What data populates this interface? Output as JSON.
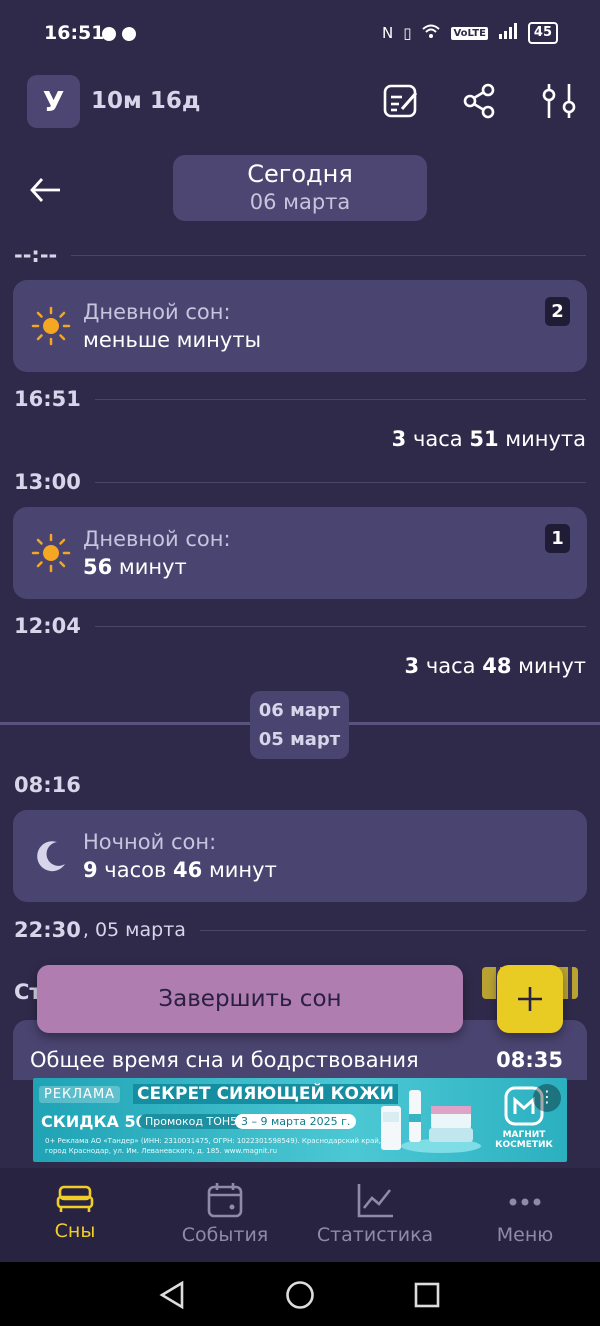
{
  "status_bar": {
    "time": "16:51",
    "network": "VoLTE",
    "battery": "45"
  },
  "top_bar": {
    "avatar_letter": "У",
    "age": "10м 16д"
  },
  "date_header": {
    "title": "Сегодня",
    "date": "06 марта"
  },
  "timeline": {
    "marker_empty": "--:--",
    "nap1": {
      "label": "Дневной сон:",
      "value": "меньше минуты",
      "badge": "2"
    },
    "time_1651": "16:51",
    "awake1": {
      "n1": "3",
      "u1": " часа ",
      "n2": "51",
      "u2": " минута"
    },
    "time_1300": "13:00",
    "nap2": {
      "label": "Дневной сон:",
      "n": "56",
      "u": " минут",
      "badge": "1"
    },
    "time_1204": "12:04",
    "awake2": {
      "n1": "3",
      "u1": " часа ",
      "n2": "48",
      "u2": " минут"
    },
    "day_chip_top": "06 март",
    "day_chip_bottom": "05 март",
    "time_0816": "08:16",
    "night": {
      "label": "Ночной сон:",
      "n1": "9",
      "u1": " часов ",
      "n2": "46",
      "u2": " минут"
    },
    "time_2230": "22:30",
    "time_2230_sub": ", 05 марта"
  },
  "sheet": {
    "peek_letters": "Ст",
    "total_label": "Общее время сна и бодрствования",
    "total_value": "08:35"
  },
  "actions": {
    "finish_label": "Завершить сон"
  },
  "ad": {
    "tag": "РЕКЛАМА",
    "headline": "СЕКРЕТ СИЯЮЩЕЙ КОЖИ",
    "discount": "СКИДКА 50%",
    "promo": "Промокод ТОН50",
    "dates": "3 – 9 марта 2025 г.",
    "fine_print": "0+ Реклама АО «Тандер» (ИНН: 2310031475, ОГРН: 1022301598549). Краснодарский край, город Краснодар, ул. Им. Леваневского, д. 185. www.magnit.ru",
    "brand_line1": "МАГНИТ",
    "brand_line2": "КОСМЕТИК"
  },
  "bottom_nav": [
    {
      "label": "Сны",
      "icon": "bed-icon",
      "active": true
    },
    {
      "label": "События",
      "icon": "calendar-icon",
      "active": false
    },
    {
      "label": "Статистика",
      "icon": "chart-icon",
      "active": false
    },
    {
      "label": "Меню",
      "icon": "more-icon",
      "active": false
    }
  ],
  "colors": {
    "background": "#2f2a4a",
    "card": "#4a4470",
    "accent_yellow": "#e8cc23",
    "finish_button": "#b07db0",
    "nav_active": "#f1cd2a"
  }
}
